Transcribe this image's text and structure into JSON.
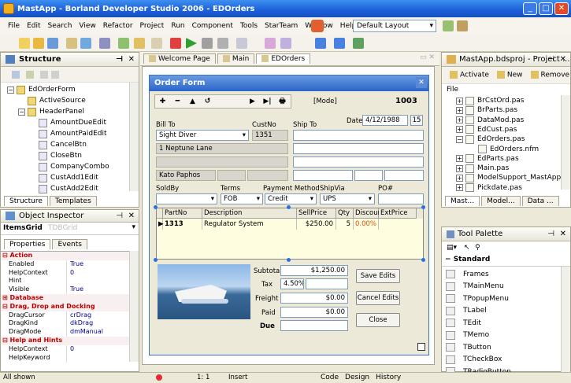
{
  "window": {
    "title": "MastApp - Borland Developer Studio 2006 - EDOrders",
    "minimize": "_",
    "maximize": "□",
    "close": "✕"
  },
  "menu": [
    "File",
    "Edit",
    "Search",
    "View",
    "Refactor",
    "Project",
    "Run",
    "Component",
    "Tools",
    "StarTeam",
    "Window",
    "Help"
  ],
  "layout_select": "Default Layout",
  "structure": {
    "title": "Structure",
    "pin": "⊣",
    "close": "✕",
    "items": [
      {
        "label": "EdOrderForm",
        "depth": 0,
        "expander": "−",
        "icon": "form-icon"
      },
      {
        "label": "ActiveSource",
        "depth": 1,
        "expander": "",
        "icon": "datasource-icon"
      },
      {
        "label": "HeaderPanel",
        "depth": 1,
        "expander": "−",
        "icon": "panel-icon"
      },
      {
        "label": "AmountDueEdit",
        "depth": 2,
        "expander": "",
        "icon": "edit-icon"
      },
      {
        "label": "AmountPaidEdit",
        "depth": 2,
        "expander": "",
        "icon": "edit-icon"
      },
      {
        "label": "CancelBtn",
        "depth": 2,
        "expander": "",
        "icon": "button-icon"
      },
      {
        "label": "CloseBtn",
        "depth": 2,
        "expander": "",
        "icon": "button-icon"
      },
      {
        "label": "CompanyCombo",
        "depth": 2,
        "expander": "",
        "icon": "combo-icon"
      },
      {
        "label": "CustAdd1Edit",
        "depth": 2,
        "expander": "",
        "icon": "edit-icon"
      },
      {
        "label": "CustAdd2Edit",
        "depth": 2,
        "expander": "",
        "icon": "edit-icon"
      }
    ],
    "tabs": [
      "Structure",
      "Templates"
    ]
  },
  "object_inspector": {
    "title": "Object Inspector",
    "pin": "⊣",
    "close": "✕",
    "selected": "ItemsGrid",
    "selected_type": "TDBGrid",
    "tabs": [
      "Properties",
      "Events"
    ],
    "rows": [
      {
        "kind": "cat",
        "key": "⊟ Action",
        "value": ""
      },
      {
        "kind": "prop",
        "key": "Enabled",
        "value": "True"
      },
      {
        "kind": "prop",
        "key": "HelpContext",
        "value": "0"
      },
      {
        "kind": "prop",
        "key": "Hint",
        "value": ""
      },
      {
        "kind": "prop",
        "key": "Visible",
        "value": "True"
      },
      {
        "kind": "cat",
        "key": "⊞ Database",
        "value": ""
      },
      {
        "kind": "cat",
        "key": "⊟ Drag, Drop and Docking",
        "value": ""
      },
      {
        "kind": "prop",
        "key": "DragCursor",
        "value": "crDrag"
      },
      {
        "kind": "prop",
        "key": "DragKind",
        "value": "dkDrag"
      },
      {
        "kind": "prop",
        "key": "DragMode",
        "value": "dmManual"
      },
      {
        "kind": "cat",
        "key": "⊟ Help and Hints",
        "value": ""
      },
      {
        "kind": "prop",
        "key": "HelpContext",
        "value": "0"
      },
      {
        "kind": "prop",
        "key": "HelpKeyword",
        "value": ""
      }
    ],
    "status": "All shown"
  },
  "editor_tabs": [
    "Welcome Page",
    "Main",
    "EDOrders"
  ],
  "order_form": {
    "title": "Order Form",
    "close": "✕",
    "nav": [
      "✚",
      "━",
      "▲",
      "↺",
      "",
      "",
      "▶",
      "▶|",
      "🖶"
    ],
    "mode": "[Mode]",
    "order_no": "1003",
    "labels": {
      "bill_to": "Bill To",
      "cust_no": "CustNo",
      "ship_to": "Ship To",
      "date": "Date",
      "sold_by": "SoldBy",
      "terms": "Terms",
      "payment_method": "Payment Method",
      "ship_via": "ShipVia",
      "po": "PO#"
    },
    "values": {
      "company": "Sight Diver",
      "cust_no": "1351",
      "date": "4/12/1988",
      "date_btn": "15",
      "addr1": "1 Neptune Lane",
      "city": "Kato Paphos",
      "terms": "FOB",
      "payment": "Credit",
      "ship_via": "UPS"
    },
    "grid": {
      "headers": [
        "PartNo",
        "Description",
        "SellPrice",
        "Qty",
        "Discount",
        "ExtPrice"
      ],
      "row": {
        "indicator": "▶",
        "part": "1313",
        "desc": "Regulator System",
        "price": "$250.00",
        "qty": "5",
        "disc": "0.00%",
        "ext": ""
      }
    },
    "totals": {
      "subtotal_label": "Subtotal",
      "subtotal": "$1,250.00",
      "tax_label": "Tax",
      "tax_rate": "4.50%",
      "tax": "",
      "freight_label": "Freight",
      "freight": "$0.00",
      "paid_label": "Paid",
      "paid": "$0.00",
      "due_label": "Due",
      "due": ""
    },
    "buttons": [
      "Save Edits",
      "Cancel Edits",
      "Close"
    ]
  },
  "project": {
    "title": "MastApp.bdsproj - Project ...",
    "pin": "⊣",
    "close": "✕",
    "actions": [
      "Activate",
      "New",
      "Remove"
    ],
    "column": "File",
    "files": [
      {
        "label": "BrCstOrd.pas",
        "exp": "+",
        "depth": 1
      },
      {
        "label": "BrParts.pas",
        "exp": "+",
        "depth": 1
      },
      {
        "label": "DataMod.pas",
        "exp": "+",
        "depth": 1
      },
      {
        "label": "EdCust.pas",
        "exp": "+",
        "depth": 1
      },
      {
        "label": "EdOrders.pas",
        "exp": "−",
        "depth": 1
      },
      {
        "label": "EdOrders.nfm",
        "exp": "",
        "depth": 2
      },
      {
        "label": "EdParts.pas",
        "exp": "+",
        "depth": 1
      },
      {
        "label": "Main.pas",
        "exp": "+",
        "depth": 1
      },
      {
        "label": "ModelSupport_MastApp",
        "exp": "+",
        "depth": 1
      },
      {
        "label": "Pickdate.pas",
        "exp": "+",
        "depth": 1
      }
    ],
    "tabs": [
      "Mast...",
      "Model...",
      "Data ..."
    ]
  },
  "tool_palette": {
    "title": "Tool Palette",
    "pin": "⊣",
    "close": "✕",
    "category": "Standard",
    "items": [
      "Frames",
      "TMainMenu",
      "TPopupMenu",
      "TLabel",
      "TEdit",
      "TMemo",
      "TButton",
      "TCheckBox",
      "TRadioButton"
    ]
  },
  "status": {
    "position": "1: 1",
    "mode": "Insert",
    "tabs": [
      "Code",
      "Design",
      "History"
    ]
  }
}
